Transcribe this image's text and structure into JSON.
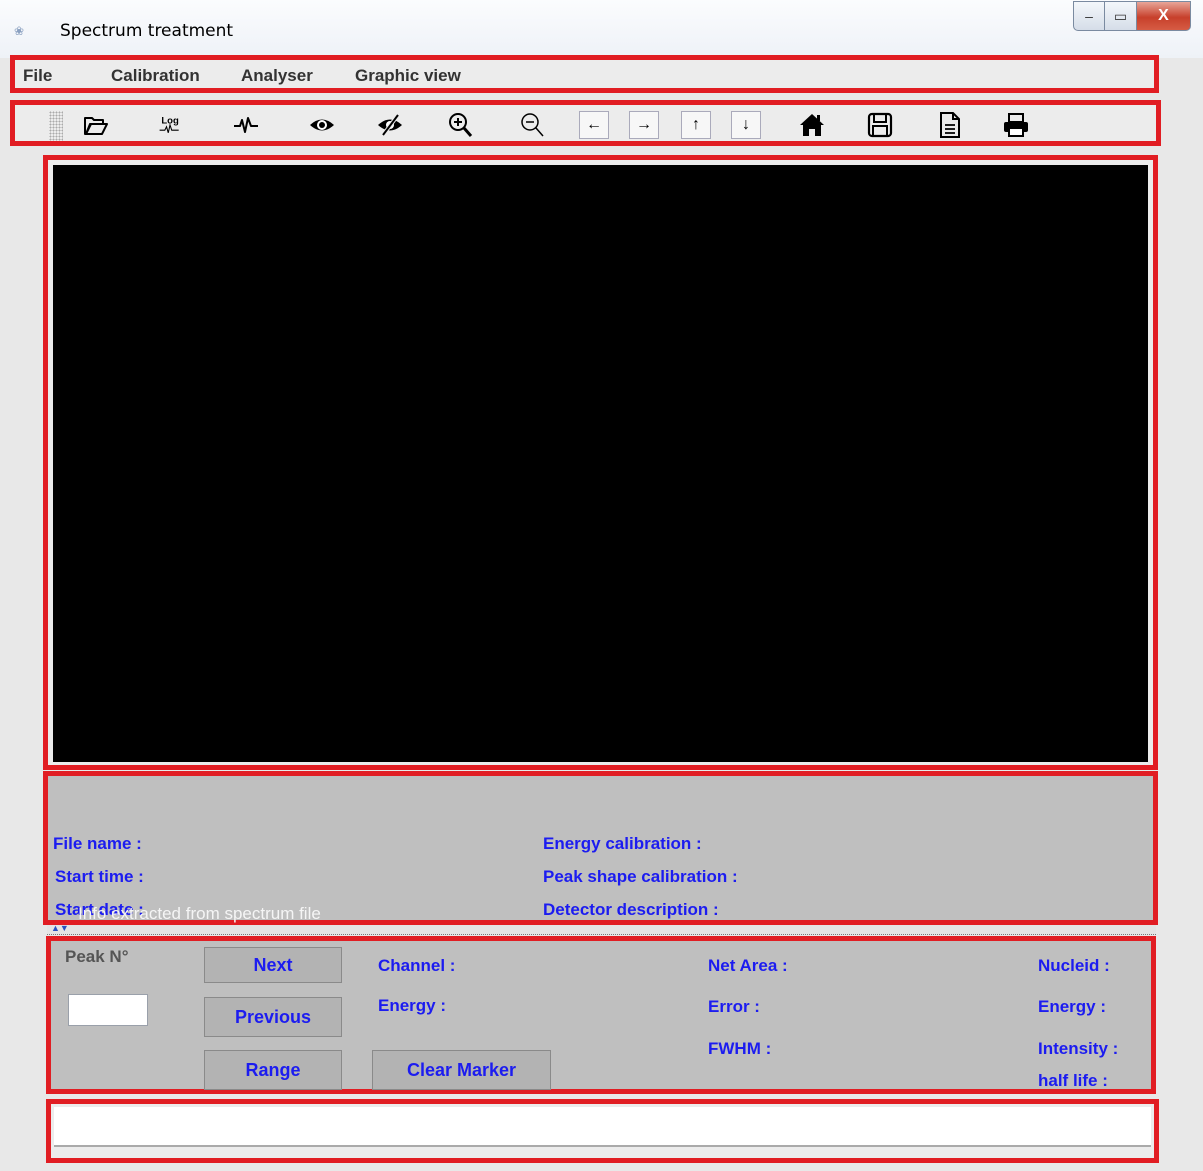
{
  "window": {
    "title": "Spectrum treatment",
    "close_glyph": "X",
    "min_glyph": "–",
    "max_glyph": "▭"
  },
  "menu": [
    "File",
    "Calibration",
    "Analyser",
    "Graphic view"
  ],
  "toolbar": {
    "icons": [
      "open-folder-icon",
      "log-scale-icon",
      "spectrum-icon",
      "show-icon",
      "hide-icon",
      "zoom-in-icon",
      "zoom-out-icon",
      "arrow-left-icon",
      "arrow-right-icon",
      "arrow-up-icon",
      "arrow-down-icon",
      "home-icon",
      "save-icon",
      "document-icon",
      "print-icon"
    ],
    "log_text": "Log",
    "arrows": {
      "left": "←",
      "right": "→",
      "up": "↑",
      "down": "↓"
    }
  },
  "info": {
    "file_name": "File name  :",
    "start_time": "Start time :",
    "start_date": "Start date :",
    "energy_calibration": "Energy calibration        :",
    "peak_shape_calibration": "Peak shape calibration :",
    "detector_description": "Detector description     :",
    "tooltip": "Info extracted from spectrum file"
  },
  "peak": {
    "title": "Peak N°",
    "input_value": "",
    "next": "Next",
    "previous": "Previous",
    "range": "Range",
    "clear_marker": "Clear Marker",
    "channel": "Channel :",
    "energy": "Energy   :",
    "net_area": "Net Area   :",
    "error": "Error         :",
    "fwhm": "FWHM        :",
    "nucleid": "Nucleid  :",
    "energy_right": "Energy   :",
    "intensity": "Intensity :",
    "half_life": "half life   :"
  },
  "status": {
    "text": ""
  },
  "colors": {
    "highlight_border": "#e11d23",
    "label_blue": "#1c1cf0",
    "panel_gray": "#bfbfbf",
    "plot_bg": "#000000"
  }
}
